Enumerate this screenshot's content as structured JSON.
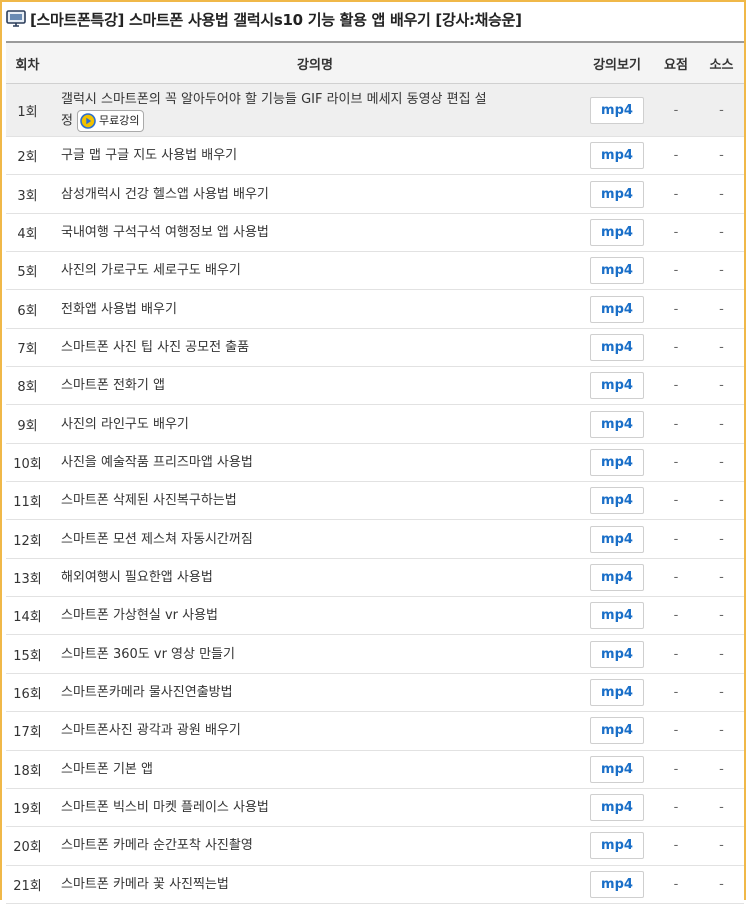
{
  "page": {
    "title": "[스마트폰특강] 스마트폰 사용법 갤럭시s10 기능 활용 앱 배우기 [강사:채승운]"
  },
  "table": {
    "headers": {
      "no": "회차",
      "name": "강의명",
      "watch": "강의보기",
      "summary": "요점",
      "source": "소스"
    },
    "free_badge": "무료강의",
    "rows": [
      {
        "no": "1회",
        "name": "갤럭시 스마트폰의 꼭 알아두어야 할 기능들 GIF 라이브 메세지 동영상 편집 설정",
        "mp4": "mp4",
        "summary": "-",
        "source": "-"
      },
      {
        "no": "2회",
        "name": "구글 맵 구글 지도 사용법 배우기",
        "mp4": "mp4",
        "summary": "-",
        "source": "-"
      },
      {
        "no": "3회",
        "name": "삼성개럭시 건강 헬스앱 사용법 배우기",
        "mp4": "mp4",
        "summary": "-",
        "source": "-"
      },
      {
        "no": "4회",
        "name": "국내여행 구석구석 여행정보 앱 사용법",
        "mp4": "mp4",
        "summary": "-",
        "source": "-"
      },
      {
        "no": "5회",
        "name": "사진의 가로구도 세로구도 배우기",
        "mp4": "mp4",
        "summary": "-",
        "source": "-"
      },
      {
        "no": "6회",
        "name": "전화앱 사용법 배우기",
        "mp4": "mp4",
        "summary": "-",
        "source": "-"
      },
      {
        "no": "7회",
        "name": "스마트폰 사진 팁 사진 공모전 출품",
        "mp4": "mp4",
        "summary": "-",
        "source": "-"
      },
      {
        "no": "8회",
        "name": "스마트폰 전화기 앱",
        "mp4": "mp4",
        "summary": "-",
        "source": "-"
      },
      {
        "no": "9회",
        "name": "사진의 라인구도 배우기",
        "mp4": "mp4",
        "summary": "-",
        "source": "-"
      },
      {
        "no": "10회",
        "name": "사진을 예술작품 프리즈마앱 사용법",
        "mp4": "mp4",
        "summary": "-",
        "source": "-"
      },
      {
        "no": "11회",
        "name": "스마트폰 삭제된 사진복구하는법",
        "mp4": "mp4",
        "summary": "-",
        "source": "-"
      },
      {
        "no": "12회",
        "name": "스마트폰 모션 제스쳐 자동시간꺼짐",
        "mp4": "mp4",
        "summary": "-",
        "source": "-"
      },
      {
        "no": "13회",
        "name": "해외여행시 필요한앱 사용법",
        "mp4": "mp4",
        "summary": "-",
        "source": "-"
      },
      {
        "no": "14회",
        "name": "스마트폰 가상현실 vr 사용법",
        "mp4": "mp4",
        "summary": "-",
        "source": "-"
      },
      {
        "no": "15회",
        "name": "스마트폰 360도 vr 영상 만들기",
        "mp4": "mp4",
        "summary": "-",
        "source": "-"
      },
      {
        "no": "16회",
        "name": "스마트폰카메라 물사진연출방법",
        "mp4": "mp4",
        "summary": "-",
        "source": "-"
      },
      {
        "no": "17회",
        "name": "스마트폰사진 광각과 광원 배우기",
        "mp4": "mp4",
        "summary": "-",
        "source": "-"
      },
      {
        "no": "18회",
        "name": "스마트폰 기본 앱",
        "mp4": "mp4",
        "summary": "-",
        "source": "-"
      },
      {
        "no": "19회",
        "name": "스마트폰 빅스비 마켓 플레이스 사용법",
        "mp4": "mp4",
        "summary": "-",
        "source": "-"
      },
      {
        "no": "20회",
        "name": "스마트폰 카메라 순간포착 사진촬영",
        "mp4": "mp4",
        "summary": "-",
        "source": "-"
      },
      {
        "no": "21회",
        "name": "스마트폰 카메라 꽃 사진찍는법",
        "mp4": "mp4",
        "summary": "-",
        "source": "-"
      }
    ]
  },
  "colors": {
    "frame": "#f0b848",
    "mp4_text": "#1a6fc8",
    "header_bg": "#f4f4f4",
    "first_row_bg": "#efefef"
  },
  "icons": {
    "title": "monitor-lecture-icon",
    "free": "play-circle-icon"
  }
}
